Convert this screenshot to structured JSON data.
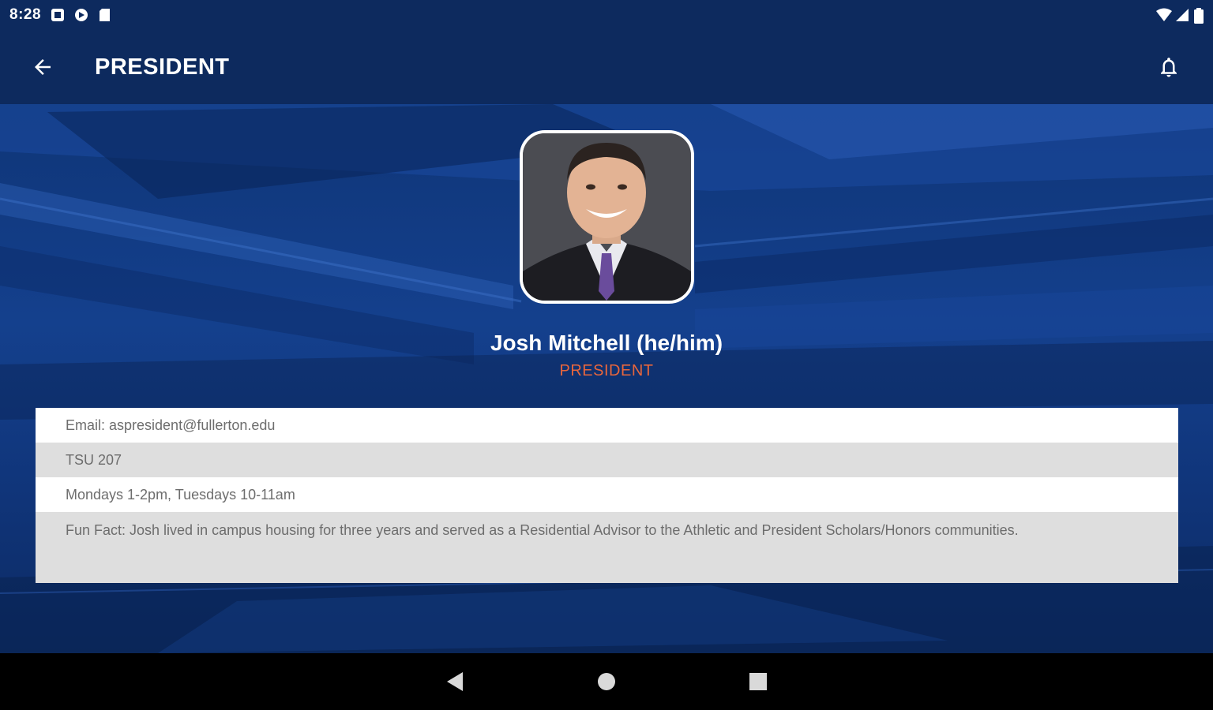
{
  "status_bar": {
    "time": "8:28",
    "left_icons": [
      "notification-square-icon",
      "media-icon",
      "sd-card-icon"
    ],
    "right_icons": [
      "wifi-icon",
      "cell-signal-icon",
      "battery-icon"
    ]
  },
  "app_bar": {
    "title": "PRESIDENT",
    "back_icon": "arrow-left-icon",
    "notification_icon": "bell-icon"
  },
  "profile": {
    "name": "Josh Mitchell (he/him)",
    "role": "PRESIDENT",
    "avatar": "portrait-photo"
  },
  "info": {
    "email": "Email: aspresident@fullerton.edu",
    "room": "TSU 207",
    "hours": "Mondays 1-2pm, Tuesdays 10-11am",
    "fun_fact": "Fun Fact: Josh lived in campus housing for three years and served as a Residential Advisor to the Athletic and President Scholars/Honors communities."
  },
  "nav_bar": {
    "back": "triangle-back-icon",
    "home": "circle-home-icon",
    "recents": "square-recents-icon"
  },
  "colors": {
    "primary": "#0d2a5e",
    "accent": "#e8663c",
    "card_white": "#ffffff",
    "card_gray": "#dedede"
  }
}
